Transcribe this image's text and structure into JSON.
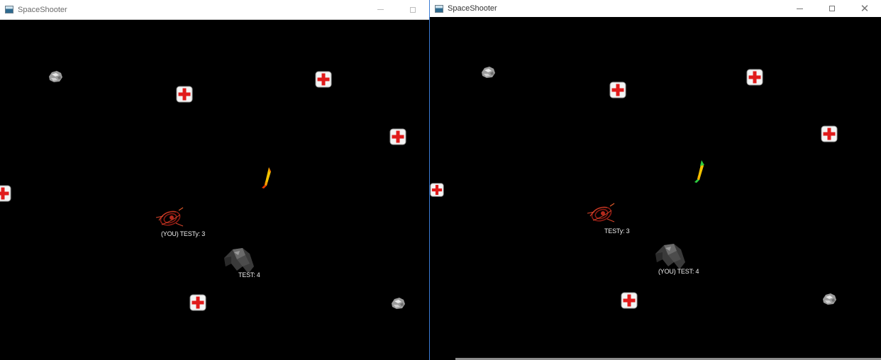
{
  "windows": [
    {
      "title": "SpaceShooter",
      "player_label": "(YOU) TESTy: 3",
      "enemy_label": "TEST: 4"
    },
    {
      "title": "SpaceShooter",
      "player_label": "TESTy: 3",
      "enemy_label": "(YOU) TEST: 4"
    }
  ],
  "icons": {
    "app": "app-icon",
    "health": "health-pack-icon",
    "asteroid": "asteroid-icon",
    "rocket": "rocket-icon",
    "player_ship": "red-ship-icon",
    "enemy_ship": "dark-ship-icon"
  },
  "colors": {
    "background": "#000000",
    "health_cross": "#e01b1b",
    "label_text": "#f0f0f0",
    "active_border": "#3a7bd5"
  }
}
